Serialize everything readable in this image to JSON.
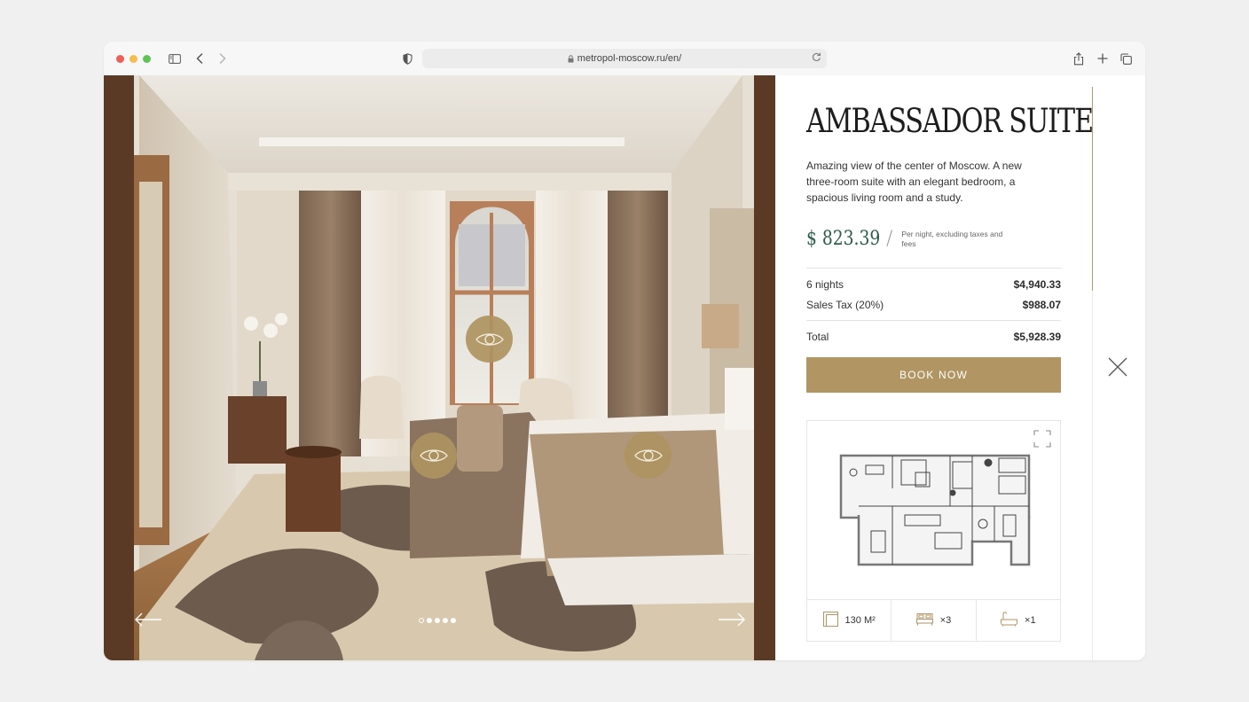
{
  "browser": {
    "url": "metropol-moscow.ru/en/",
    "icons": [
      "sidebar-icon",
      "back-icon",
      "forward-icon",
      "shield-icon",
      "lock-icon",
      "reload-icon",
      "share-icon",
      "new-tab-icon",
      "tabs-icon"
    ]
  },
  "gallery": {
    "slides_total": 5,
    "active_slide": 1,
    "hotspot_icon": "eye-icon",
    "prev_icon": "arrow-left-icon",
    "next_icon": "arrow-right-icon"
  },
  "room": {
    "title": "AMBASSADOR SUITE",
    "description": "Amazing view of the center of Moscow. A new three-room suite with an elegant bedroom, a spacious living room and a study.",
    "price": "$ 823.39",
    "price_separator": "/",
    "price_note": "Per night, excluding taxes and fees"
  },
  "booking": {
    "lines": [
      {
        "label": "6 nights",
        "amount": "$4,940.33"
      },
      {
        "label": "Sales Tax (20%)",
        "amount": "$988.07"
      }
    ],
    "total": {
      "label": "Total",
      "amount": "$5,928.39"
    },
    "button_label": "BOOK NOW"
  },
  "floorplan": {
    "expand_icon": "expand-icon",
    "stats": [
      {
        "icon": "area-icon",
        "value": "130 M²"
      },
      {
        "icon": "bed-icon",
        "value": "×3"
      },
      {
        "icon": "bathtub-icon",
        "value": "×1"
      }
    ]
  },
  "colors": {
    "accent": "#b19563",
    "price": "#2e5c4c",
    "text": "#333333"
  }
}
